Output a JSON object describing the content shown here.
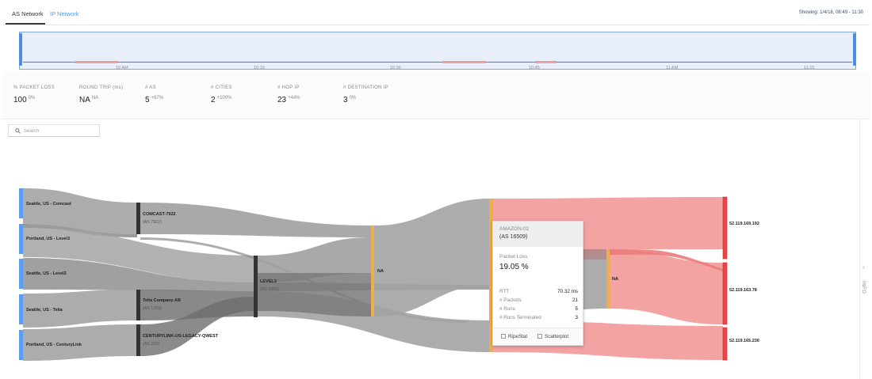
{
  "tabs": [
    {
      "label": "AS Network",
      "active": true
    },
    {
      "label": "IP Network",
      "active": false
    }
  ],
  "showing": "Showing: 1/4/18, 08:49 - 11:30",
  "timeline": {
    "ticks": [
      "10 AM",
      "10:15",
      "10:30",
      "10:45",
      "11 AM",
      "11:15"
    ]
  },
  "stats": [
    {
      "label": "% PACKET LOSS",
      "value": "100",
      "delta": "0%"
    },
    {
      "label": "ROUND TRIP (ms)",
      "value": "NA",
      "delta": "NA"
    },
    {
      "label": "# AS",
      "value": "5",
      "delta": "+67%"
    },
    {
      "label": "# CITIES",
      "value": "2",
      "delta": "+100%"
    },
    {
      "label": "# HOP IP",
      "value": "23",
      "delta": "+44%"
    },
    {
      "label": "# DESTINATION IP",
      "value": "3",
      "delta": "0%"
    }
  ],
  "search": {
    "placeholder": "Search"
  },
  "rail": {
    "label": "INFO"
  },
  "sources": [
    {
      "label": "Seattle, US - Comcast"
    },
    {
      "label": "Portland, US - Level3"
    },
    {
      "label": "Seattle, US - Level3"
    },
    {
      "label": "Seattle, US - Telia"
    },
    {
      "label": "Portland, US - CenturyLink"
    }
  ],
  "as_nodes": [
    {
      "name": "COMCAST-7922",
      "as": "(AS 7922)"
    },
    {
      "name": "LEVEL3",
      "as": "(AS 3356)"
    },
    {
      "name": "Telia Company AB",
      "as": "(AS 1299)"
    },
    {
      "name": "CENTURYLINK-US-LEGACY-QWEST",
      "as": "(AS 209)"
    },
    {
      "name": "NA",
      "as": ""
    },
    {
      "name": "NA",
      "as": ""
    }
  ],
  "destinations": [
    {
      "ip": "52.119.169.192"
    },
    {
      "ip": "52.119.163.78"
    },
    {
      "ip": "52.119.165.236"
    }
  ],
  "tooltip": {
    "name": "AMAZON-02",
    "as": "(AS 16509)",
    "packet_loss_label": "Packet Loss",
    "packet_loss_value": "19.05 %",
    "rows": [
      {
        "label": "RTT",
        "value": "70.32 ms"
      },
      {
        "label": "# Packets",
        "value": "21"
      },
      {
        "label": "# Runs",
        "value": "5"
      },
      {
        "label": "# Runs Terminated",
        "value": "3"
      }
    ],
    "links": [
      "RipeStat",
      "Scatterplot"
    ]
  },
  "colors": {
    "source_node": "#5b9ef0",
    "as_node": "#333333",
    "na_node": "#f0ad4e",
    "dest_node": "#e8474a",
    "link_gray": "#9e9e9e",
    "link_red": "#f4a3a3",
    "accent": "#4d8ee0"
  }
}
